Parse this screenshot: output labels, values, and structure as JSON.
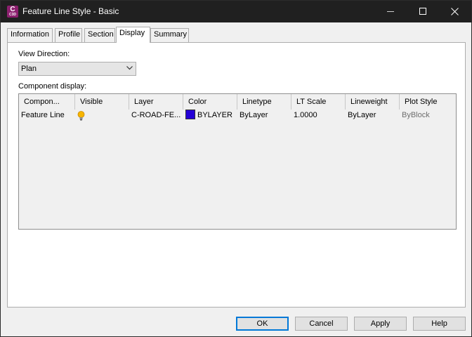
{
  "window": {
    "title": "Feature Line Style - Basic",
    "app_icon": {
      "letter": "C",
      "version": "C3D",
      "color": "#8c1f6e"
    }
  },
  "tabs": [
    {
      "label": "Information",
      "active": false
    },
    {
      "label": "Profile",
      "active": false
    },
    {
      "label": "Section",
      "active": false
    },
    {
      "label": "Display",
      "active": true
    },
    {
      "label": "Summary",
      "active": false
    }
  ],
  "display": {
    "view_direction_label": "View Direction:",
    "view_direction_value": "Plan",
    "component_display_label": "Component display:",
    "columns": [
      "Compon...",
      "Visible",
      "Layer",
      "Color",
      "Linetype",
      "LT Scale",
      "Lineweight",
      "Plot Style"
    ],
    "rows": [
      {
        "component": "Feature Line",
        "visible_icon": "lightbulb-on-icon",
        "layer": "C-ROAD-FE...",
        "color_swatch": "#2400d6",
        "color": "BYLAYER",
        "linetype": "ByLayer",
        "lt_scale": "1.0000",
        "lineweight": "ByLayer",
        "plot_style": "ByBlock"
      }
    ]
  },
  "buttons": {
    "ok": "OK",
    "cancel": "Cancel",
    "apply": "Apply",
    "help": "Help"
  }
}
